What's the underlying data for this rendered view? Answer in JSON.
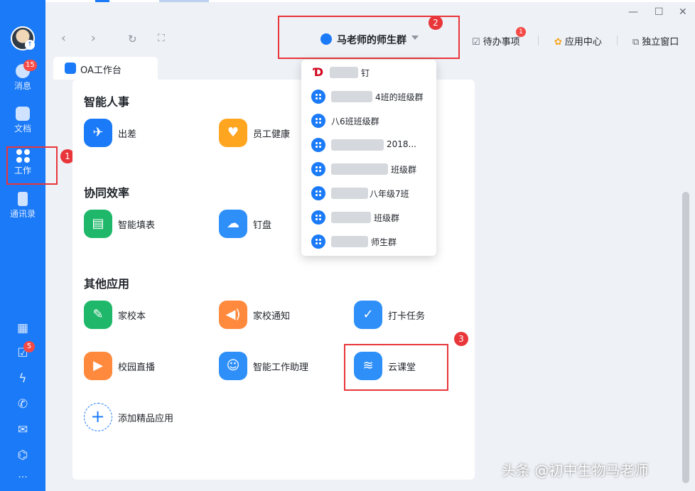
{
  "sidebar": {
    "avatar_badge": "↑",
    "nav": [
      {
        "label": "消息",
        "badge": "15"
      },
      {
        "label": "文档"
      },
      {
        "label": "工作"
      },
      {
        "label": "通讯录"
      }
    ],
    "bottom_badge": "5",
    "more_label": "···"
  },
  "topbar": {
    "group_name": "马老师的师生群",
    "todo_label": "待办事项",
    "todo_badge": "1",
    "app_center_label": "应用中心",
    "window_label": "独立窗口"
  },
  "tab": {
    "label": "OA工作台"
  },
  "sections": {
    "hr": {
      "title": "智能人事",
      "apps": [
        "出差",
        "员工健康"
      ]
    },
    "collab": {
      "title": "协同效率",
      "apps": [
        "智能填表",
        "钉盘"
      ]
    },
    "other": {
      "title": "其他应用",
      "apps": [
        "家校本",
        "家校通知",
        "打卡任务",
        "校园直播",
        "智能工作助理",
        "云课堂"
      ]
    },
    "add_app": "添加精品应用"
  },
  "dropdown": {
    "items": [
      {
        "label": "钉"
      },
      {
        "label": "4班的班级群"
      },
      {
        "label": "八6班班级群"
      },
      {
        "label": "2018..."
      },
      {
        "label": "班级群"
      },
      {
        "label": "八年级7班"
      },
      {
        "label": "班级群"
      },
      {
        "label": "师生群"
      }
    ]
  },
  "annotations": {
    "n1": "1",
    "n2": "2",
    "n3": "3"
  },
  "watermark": "头条 @初中生物马老师",
  "colors": {
    "accent": "#1a7af8",
    "annotation": "#e8363a",
    "badge": "#f54a45"
  }
}
